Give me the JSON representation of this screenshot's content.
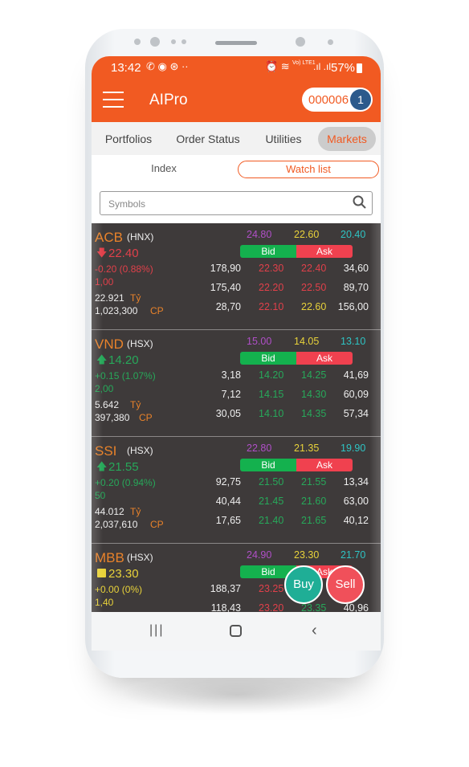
{
  "status_bar": {
    "time": "13:42",
    "battery": "57%",
    "network": "Vo) LTE1"
  },
  "header": {
    "title": "AIPro",
    "account": "000006",
    "badge": "1"
  },
  "tabs": [
    {
      "label": "Portfolios",
      "active": false
    },
    {
      "label": "Order Status",
      "active": false
    },
    {
      "label": "Utilities",
      "active": false
    },
    {
      "label": "Markets",
      "active": true
    }
  ],
  "subtabs": {
    "index": "Index",
    "watchlist": "Watch list"
  },
  "search": {
    "placeholder": "Symbols"
  },
  "labels": {
    "bid": "Bid",
    "ask": "Ask",
    "ty": "Tỷ",
    "cp": "CP"
  },
  "colors": {
    "accent": "#f15a22",
    "up": "#27a85a",
    "down": "#e0404a",
    "ref": "#e8d23a",
    "ceiling": "#b04fc8",
    "floor": "#2ec4c4"
  },
  "stocks": [
    {
      "symbol": "ACB",
      "exchange": "(HNX)",
      "trend": "down",
      "price": "22.40",
      "change": "-0.20 (0.88%)",
      "sub": "1,00",
      "value": "22.921",
      "volume": "1,023,300",
      "ceiling": "24.80",
      "ref": "22.60",
      "floor": "20.40",
      "rows": [
        [
          "178,90",
          "22.30",
          "22.40",
          "34,60"
        ],
        [
          "175,40",
          "22.20",
          "22.50",
          "89,70"
        ],
        [
          "28,70",
          "22.10",
          "22.60",
          "156,00"
        ]
      ],
      "rowcolors": [
        [
          "down",
          "down"
        ],
        [
          "down",
          "down"
        ],
        [
          "down",
          "ref"
        ]
      ]
    },
    {
      "symbol": "VND",
      "exchange": "(HSX)",
      "trend": "up",
      "price": "14.20",
      "change": "+0.15 (1.07%)",
      "sub": "2,00",
      "value": "5.642",
      "volume": "397,380",
      "ceiling": "15.00",
      "ref": "14.05",
      "floor": "13.10",
      "rows": [
        [
          "3,18",
          "14.20",
          "14.25",
          "41,69"
        ],
        [
          "7,12",
          "14.15",
          "14.30",
          "60,09"
        ],
        [
          "30,05",
          "14.10",
          "14.35",
          "57,34"
        ]
      ],
      "rowcolors": [
        [
          "up",
          "up"
        ],
        [
          "up",
          "up"
        ],
        [
          "up",
          "up"
        ]
      ]
    },
    {
      "symbol": "SSI",
      "exchange": "(HSX)",
      "trend": "up",
      "price": "21.55",
      "change": "+0.20 (0.94%)",
      "sub": "50",
      "value": "44.012",
      "volume": "2,037,610",
      "ceiling": "22.80",
      "ref": "21.35",
      "floor": "19.90",
      "rows": [
        [
          "92,75",
          "21.50",
          "21.55",
          "13,34"
        ],
        [
          "40,44",
          "21.45",
          "21.60",
          "63,00"
        ],
        [
          "17,65",
          "21.40",
          "21.65",
          "40,12"
        ]
      ],
      "rowcolors": [
        [
          "up",
          "up"
        ],
        [
          "up",
          "up"
        ],
        [
          "up",
          "up"
        ]
      ]
    },
    {
      "symbol": "MBB",
      "exchange": "(HSX)",
      "trend": "flat",
      "price": "23.30",
      "change": "+0.00 (0%)",
      "sub": "1,40",
      "value": "",
      "volume": "",
      "ceiling": "24.90",
      "ref": "23.30",
      "floor": "21.70",
      "rows": [
        [
          "188,37",
          "23.25",
          "",
          ""
        ],
        [
          "118,43",
          "23.20",
          "23.35",
          "40,96"
        ]
      ],
      "rowcolors": [
        [
          "down",
          "up"
        ],
        [
          "down",
          "up"
        ]
      ]
    }
  ],
  "actions": {
    "buy": "Buy",
    "sell": "Sell"
  }
}
